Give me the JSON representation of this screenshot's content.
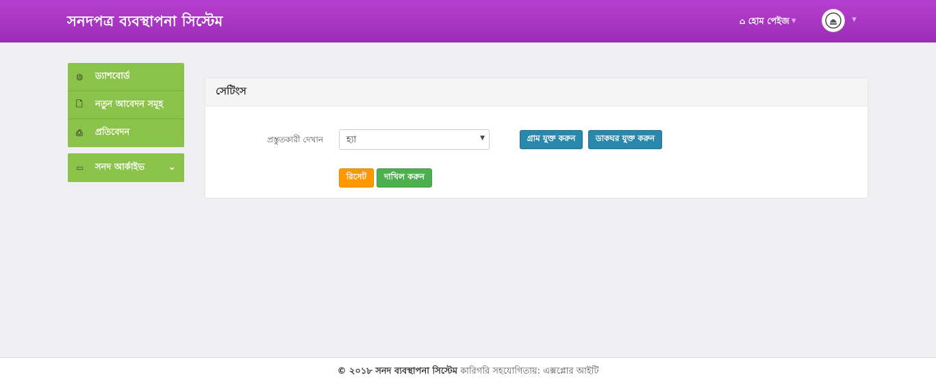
{
  "header": {
    "brand": "সনদপত্র ব্যবস্থাপনা সিস্টেম",
    "home_label": "হোম পেইজ",
    "home_icon": "home-icon",
    "avatar_icon": "emblem-logo"
  },
  "sidebar": {
    "items": [
      {
        "label": "ড্যাশবোর্ড",
        "icon": "dashboard-icon"
      },
      {
        "label": "নতুন আবেদন সমূহ",
        "icon": "file-icon"
      },
      {
        "label": "প্রতিবেদন",
        "icon": "print-icon"
      }
    ],
    "archive": {
      "label": "সনদ আর্কাইভ",
      "icon": "inbox-icon"
    }
  },
  "panel": {
    "title": "সেটিংস",
    "field_label": "প্রস্তুতকারী দেখান",
    "select_value": "হ্যা",
    "btn_add_village": "গ্রাম যুক্ত করুন",
    "btn_add_postoffice": "ডাকঘর যুক্ত করুন",
    "btn_reset": "রিসেট",
    "btn_submit": "দাখিল করুন"
  },
  "footer": {
    "copyright": "© ২০১৮ সনদ ব্যবস্থাপনা সিস্টেম",
    "credit": "কারিগরি সহযোগিতায়: এক্সপ্লোর আইটি"
  },
  "colors": {
    "header": "#a636c0",
    "sidebar": "#8bc34a",
    "btn_blue": "#2a88ad",
    "btn_orange": "#ff9800",
    "btn_green": "#4caf50"
  }
}
